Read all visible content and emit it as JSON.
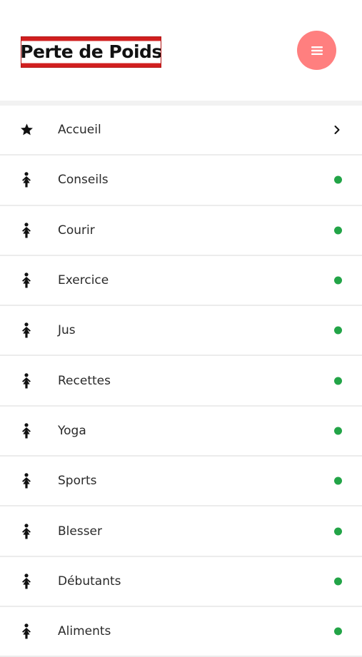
{
  "header": {
    "logo_text": "Perte de Poids",
    "menu_icon": "hamburger-icon"
  },
  "colors": {
    "menu_button": "#ff7f7f",
    "logo_background": "#d11f1f",
    "status_dot": "#22a447",
    "separator": "#f2f2f2"
  },
  "nav": {
    "items": [
      {
        "label": "Accueil",
        "icon": "star-icon",
        "indicator": "chevron-right-icon"
      },
      {
        "label": "Conseils",
        "icon": "person-icon",
        "indicator": "green-dot"
      },
      {
        "label": "Courir",
        "icon": "person-icon",
        "indicator": "green-dot"
      },
      {
        "label": "Exercice",
        "icon": "person-icon",
        "indicator": "green-dot"
      },
      {
        "label": "Jus",
        "icon": "person-icon",
        "indicator": "green-dot"
      },
      {
        "label": "Recettes",
        "icon": "person-icon",
        "indicator": "green-dot"
      },
      {
        "label": "Yoga",
        "icon": "person-icon",
        "indicator": "green-dot"
      },
      {
        "label": "Sports",
        "icon": "person-icon",
        "indicator": "green-dot"
      },
      {
        "label": "Blesser",
        "icon": "person-icon",
        "indicator": "green-dot"
      },
      {
        "label": "Débutants",
        "icon": "person-icon",
        "indicator": "green-dot"
      },
      {
        "label": "Aliments",
        "icon": "person-icon",
        "indicator": "green-dot"
      }
    ]
  }
}
